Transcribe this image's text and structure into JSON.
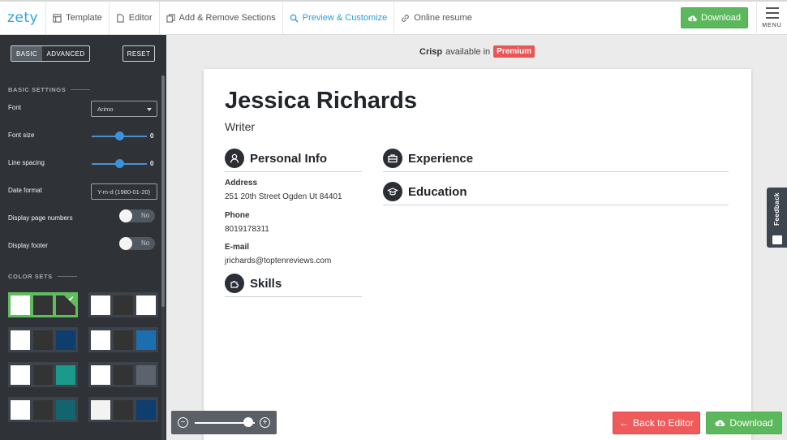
{
  "topbar": {
    "logo": "zety",
    "nav": [
      {
        "label": "Template",
        "icon": "template-icon"
      },
      {
        "label": "Editor",
        "icon": "document-icon"
      },
      {
        "label": "Add & Remove Sections",
        "icon": "copy-icon"
      },
      {
        "label": "Preview & Customize",
        "icon": "search-icon",
        "active": true
      },
      {
        "label": "Online resume",
        "icon": "link-icon"
      }
    ],
    "download_label": "Download",
    "menu_label": "MENU"
  },
  "sidebar": {
    "mode_basic": "BASIC",
    "mode_advanced": "ADVANCED",
    "reset_label": "RESET",
    "basic_settings_title": "BASIC SETTINGS",
    "font_label": "Font",
    "font_value": "Arimo",
    "font_size_label": "Font size",
    "font_size_value": "0",
    "line_spacing_label": "Line spacing",
    "line_spacing_value": "0",
    "date_format_label": "Date format",
    "date_format_value": "Y-m-d (1980-01-20)",
    "page_numbers_label": "Display page numbers",
    "page_numbers_value": "No",
    "footer_label": "Display footer",
    "footer_value": "No",
    "color_sets_title": "COLOR SETS",
    "color_sets": [
      {
        "colors": [
          "#ffffff",
          "#333333",
          "#333333"
        ],
        "selected": true
      },
      {
        "colors": [
          "#ffffff",
          "#333333",
          "#ffffff"
        ]
      },
      {
        "colors": [
          "#ffffff",
          "#333333",
          "#0f3d6e"
        ]
      },
      {
        "colors": [
          "#ffffff",
          "#333333",
          "#1b6fae"
        ]
      },
      {
        "colors": [
          "#ffffff",
          "#333333",
          "#1a9a8a"
        ]
      },
      {
        "colors": [
          "#ffffff",
          "#333333",
          "#5c636d"
        ]
      },
      {
        "colors": [
          "#ffffff",
          "#333333",
          "#146470"
        ]
      },
      {
        "colors": [
          "#f3f3f3",
          "#333333",
          "#0f3d6e"
        ]
      }
    ]
  },
  "preview": {
    "template_name": "Crisp",
    "available_text": "available in",
    "premium_label": "Premium"
  },
  "resume": {
    "name": "Jessica Richards",
    "job_title": "Writer",
    "sections": {
      "personal_info": "Personal Info",
      "experience": "Experience",
      "education": "Education",
      "skills": "Skills"
    },
    "address_label": "Address",
    "address_value": "251 20th Street Ogden Ut 84401",
    "phone_label": "Phone",
    "phone_value": "8019178311",
    "email_label": "E-mail",
    "email_value": "jrichards@toptenreviews.com"
  },
  "footer": {
    "back_label": "Back to Editor",
    "download_label": "Download",
    "feedback_label": "Feedback"
  },
  "colors": {
    "accent": "#2aa4e0",
    "green": "#5cb85c",
    "red": "#ef5a5a",
    "sidebar_bg": "#2f3338"
  }
}
